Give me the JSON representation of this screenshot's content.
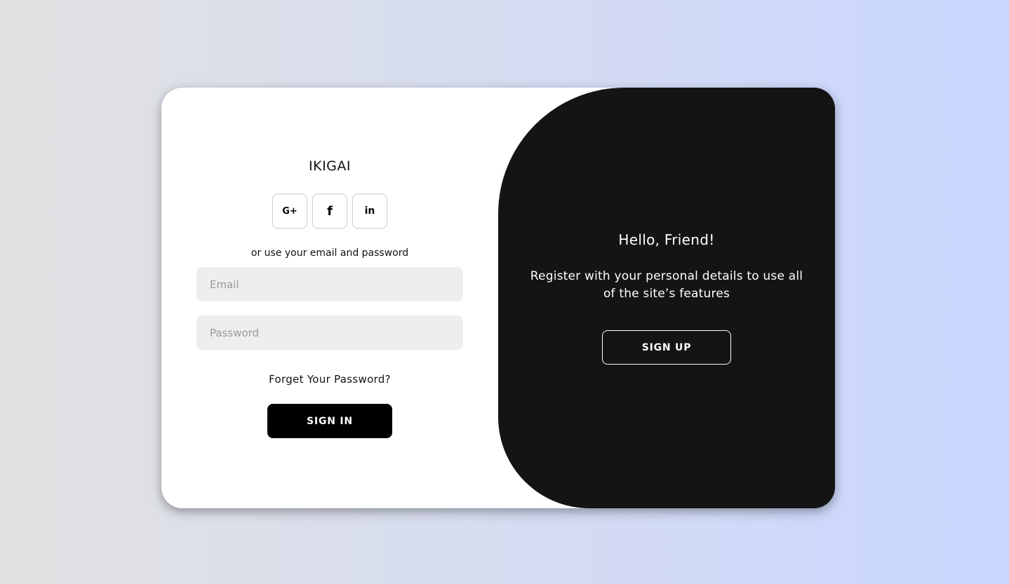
{
  "signin": {
    "brand": "IKIGAI",
    "social": [
      {
        "icon": "google-plus-icon",
        "glyph": "G+"
      },
      {
        "icon": "facebook-icon",
        "glyph": "f"
      },
      {
        "icon": "linkedin-icon",
        "glyph": "in"
      }
    ],
    "alt_text": "or use your email and password",
    "email_placeholder": "Email",
    "password_placeholder": "Password",
    "forgot_label": "Forget Your Password?",
    "submit_label": "SIGN IN"
  },
  "toggle": {
    "title": "Hello, Friend!",
    "text": "Register with your personal details to use all of the site’s features",
    "button_label": "SIGN UP"
  },
  "colors": {
    "panel_dark": "#141414",
    "button_dark": "#000000",
    "field_bg": "#eeeeee",
    "gradient_start": "#e2e2e2",
    "gradient_end": "#c9d6ff"
  }
}
